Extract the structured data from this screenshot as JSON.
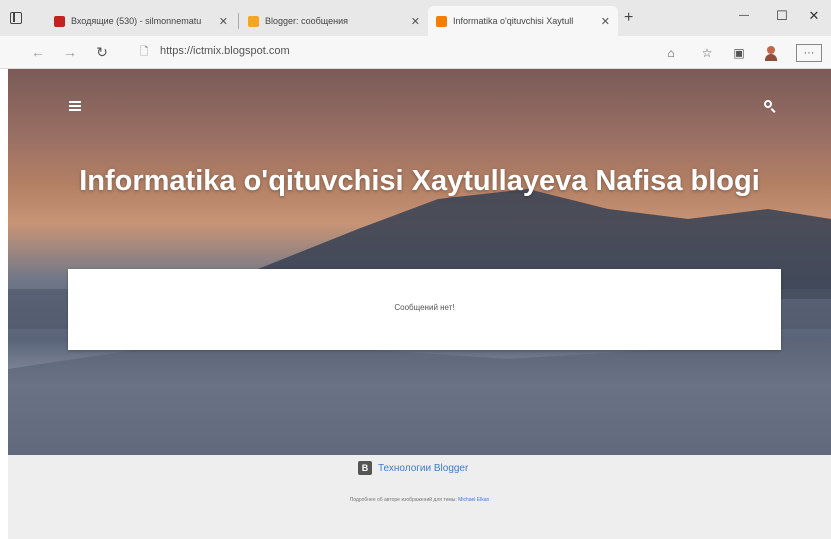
{
  "browser": {
    "tabs": [
      {
        "title": "Входящие (530) - silmonnematu",
        "favicon_color": "#c5221f",
        "active": false
      },
      {
        "title": "Blogger: сообщения",
        "favicon_color": "#f4a623",
        "active": false
      },
      {
        "title": "Informatika o'qituvchisi Xaytull",
        "favicon_color": "#f57d00",
        "active": true
      }
    ],
    "new_tab_label": "+",
    "window_controls": {
      "minimize": "—",
      "maximize": "☐",
      "close": "✕"
    },
    "url": "https://ictmix.blogspot.com",
    "icons": [
      "sidebar-icon",
      "back-icon",
      "forward-icon",
      "reload-icon",
      "page-info-icon",
      "read-aloud-icon",
      "favorites-icon",
      "collections-icon",
      "profile-icon",
      "more-icon"
    ]
  },
  "blog": {
    "title": "Informatika o'qituvchisi Xaytullayeva Nafisa blogi",
    "empty_message": "Сообщений нет!",
    "powered_by": "Технологии Blogger",
    "attribution_prefix": "Подробнее об авторе изображений для темы: ",
    "attribution_author": "Michael Elkan"
  },
  "colors": {
    "link": "#3d7bd5",
    "hero_top": "#7a5a58",
    "hero_bottom": "#6c7488",
    "footer_bg": "#eeeeee"
  }
}
